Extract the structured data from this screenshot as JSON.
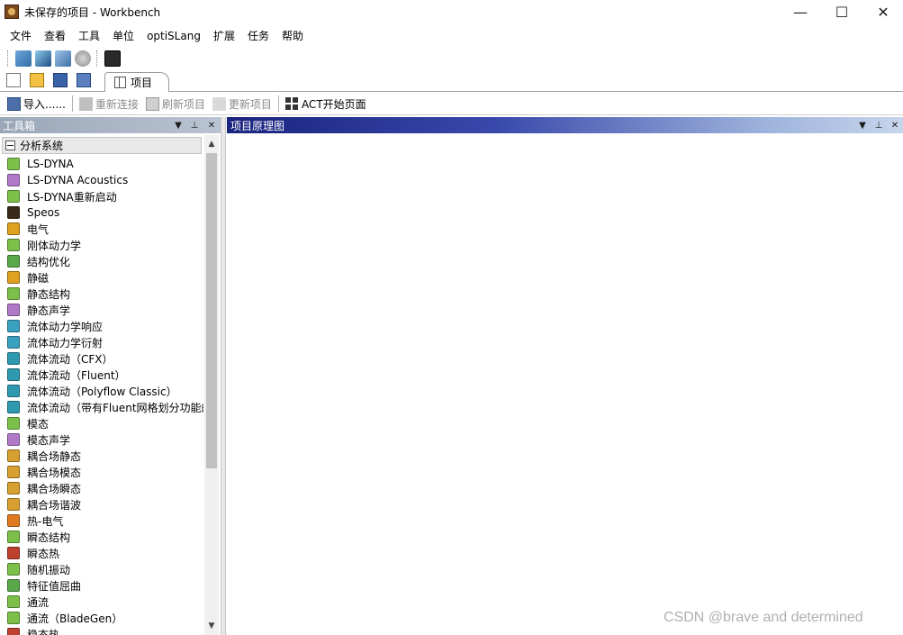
{
  "window": {
    "title": "未保存的项目 - Workbench",
    "controls": {
      "minimize": "—",
      "maximize": "☐",
      "close": "✕"
    }
  },
  "menu": [
    "文件",
    "查看",
    "工具",
    "单位",
    "optiSLang",
    "扩展",
    "任务",
    "帮助"
  ],
  "toolbar_tab": {
    "label": "项目"
  },
  "toolbar3": {
    "import": "导入......",
    "reconnect": "重新连接",
    "refresh": "刷新项目",
    "update": "更新项目",
    "act": "ACT开始页面"
  },
  "toolbox": {
    "title": "工具箱",
    "group": "分析系统",
    "items": [
      {
        "label": "LS-DYNA",
        "color": "#7cc04a"
      },
      {
        "label": "LS-DYNA Acoustics",
        "color": "#b07ac8"
      },
      {
        "label": "LS-DYNA重新启动",
        "color": "#7cc04a"
      },
      {
        "label": "Speos",
        "color": "#3b2a1a"
      },
      {
        "label": "电气",
        "color": "#e0a020"
      },
      {
        "label": "刚体动力学",
        "color": "#7cc04a"
      },
      {
        "label": "结构优化",
        "color": "#5aa84a"
      },
      {
        "label": "静磁",
        "color": "#e0a020"
      },
      {
        "label": "静态结构",
        "color": "#7cc04a"
      },
      {
        "label": "静态声学",
        "color": "#b07ac8"
      },
      {
        "label": "流体动力学响应",
        "color": "#3aa0c0"
      },
      {
        "label": "流体动力学衍射",
        "color": "#3aa0c0"
      },
      {
        "label": "流体流动（CFX）",
        "color": "#2e9ab0"
      },
      {
        "label": "流体流动（Fluent）",
        "color": "#2e9ab0"
      },
      {
        "label": "流体流动（Polyflow Classic）",
        "color": "#2e9ab0"
      },
      {
        "label": "流体流动（带有Fluent网格划分功能的",
        "color": "#2e9ab0"
      },
      {
        "label": "模态",
        "color": "#7cc04a"
      },
      {
        "label": "模态声学",
        "color": "#b07ac8"
      },
      {
        "label": "耦合场静态",
        "color": "#d8a030"
      },
      {
        "label": "耦合场模态",
        "color": "#d8a030"
      },
      {
        "label": "耦合场瞬态",
        "color": "#d8a030"
      },
      {
        "label": "耦合场谐波",
        "color": "#d8a030"
      },
      {
        "label": "热-电气",
        "color": "#e07a20"
      },
      {
        "label": "瞬态结构",
        "color": "#7cc04a"
      },
      {
        "label": "瞬态热",
        "color": "#c04030"
      },
      {
        "label": "随机振动",
        "color": "#7cc04a"
      },
      {
        "label": "特征值屈曲",
        "color": "#5aa84a"
      },
      {
        "label": "通流",
        "color": "#7cc04a"
      },
      {
        "label": "通流（BladeGen）",
        "color": "#7cc04a"
      },
      {
        "label": "稳态热",
        "color": "#c04030"
      }
    ]
  },
  "schematic": {
    "title": "项目原理图"
  },
  "watermark": "CSDN @brave and determined"
}
